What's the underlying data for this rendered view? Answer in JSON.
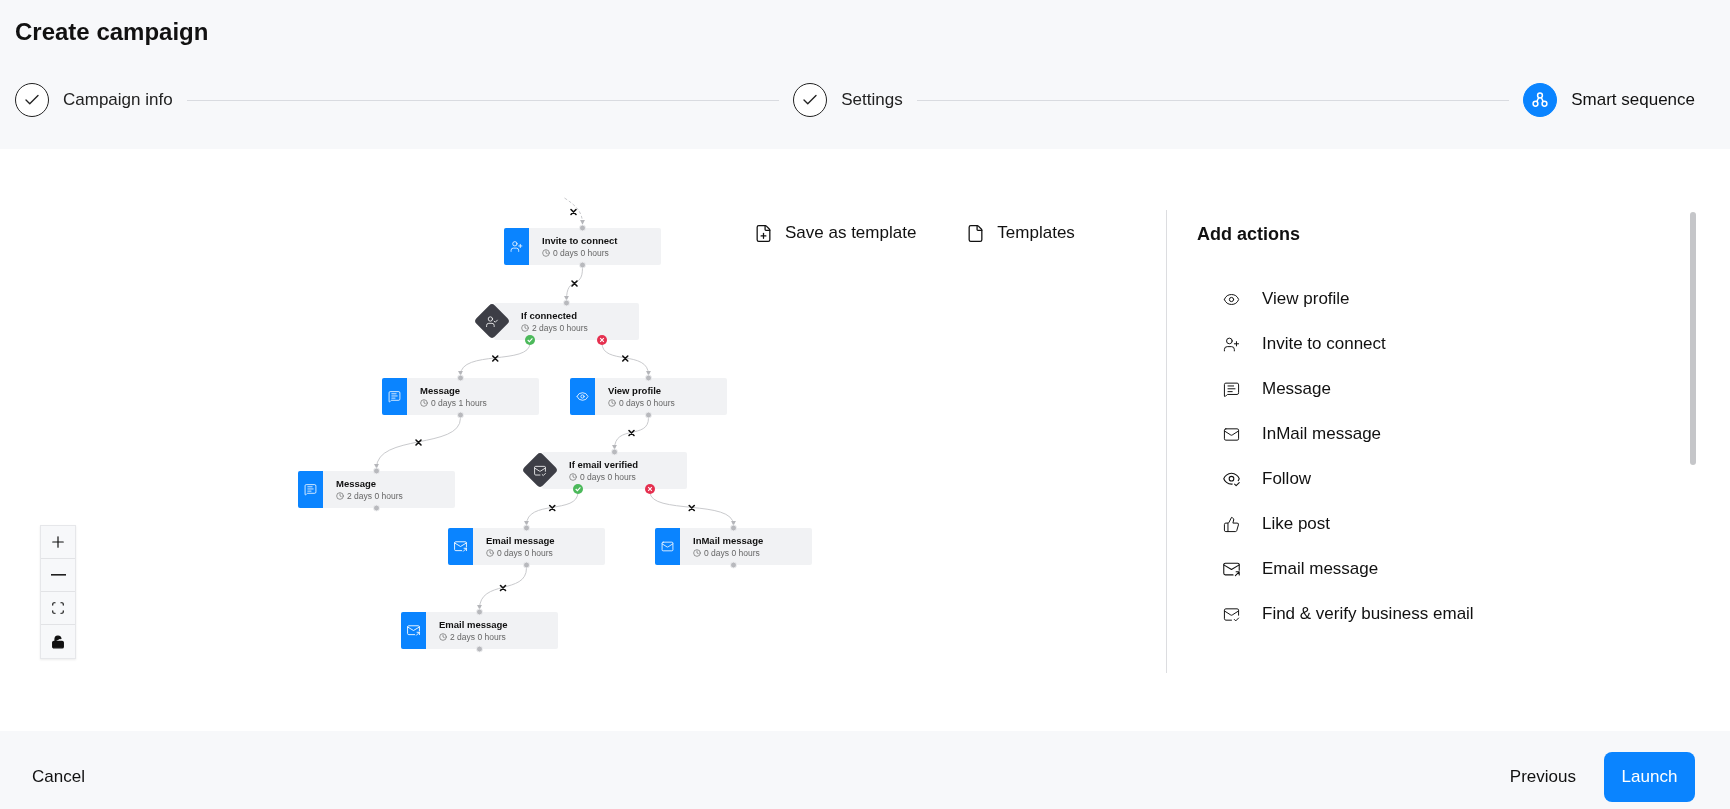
{
  "page": {
    "title": "Create campaign"
  },
  "steps": [
    {
      "label": "Campaign info",
      "completed": true,
      "selected": false
    },
    {
      "label": "Settings",
      "completed": true,
      "selected": false
    },
    {
      "label": "Smart sequence",
      "completed": false,
      "selected": true
    }
  ],
  "toolbar": [
    {
      "label": "Save as template",
      "kind": "save"
    },
    {
      "label": "Templates",
      "kind": "templates"
    }
  ],
  "sequence": {
    "kind": "invite",
    "title": "Invite to connect",
    "delay": "0 days 0 hours",
    "children": [
      {
        "kind": "connected",
        "title": "If connected",
        "delay": "2 days 0 hours",
        "children": [
          {
            "kind": "message",
            "condition_met": true,
            "title": "Message",
            "delay": "0 days 1 hours",
            "children": [
              {
                "kind": "message",
                "title": "Message",
                "delay": "2 days 0 hours"
              }
            ]
          },
          {
            "kind": "view",
            "condition_met": false,
            "title": "View profile",
            "delay": "0 days 0 hours",
            "children": [
              {
                "kind": "verified",
                "title": "If email verified",
                "delay": "0 days 0 hours",
                "children": [
                  {
                    "kind": "email",
                    "condition_met": true,
                    "title": "Email message",
                    "delay": "0 days 0 hours",
                    "children": [
                      {
                        "kind": "email",
                        "title": "Email message",
                        "delay": "2 days 0 hours"
                      }
                    ]
                  },
                  {
                    "kind": "inmail",
                    "condition_met": false,
                    "title": "InMail message",
                    "delay": "0 days 0 hours"
                  }
                ]
              }
            ]
          }
        ]
      }
    ]
  },
  "actions_panel": {
    "title": "Add actions",
    "items": [
      {
        "label": "View profile",
        "kind": "view"
      },
      {
        "label": "Invite to connect",
        "kind": "invite"
      },
      {
        "label": "Message",
        "kind": "message"
      },
      {
        "label": "InMail message",
        "kind": "inmail"
      },
      {
        "label": "Follow",
        "kind": "follow"
      },
      {
        "label": "Like post",
        "kind": "like"
      },
      {
        "label": "Email message",
        "kind": "email"
      },
      {
        "label": "Find & verify business email",
        "kind": "verify"
      }
    ]
  },
  "footer": {
    "cancel": "Cancel",
    "previous": "Previous",
    "launch": "Launch"
  }
}
